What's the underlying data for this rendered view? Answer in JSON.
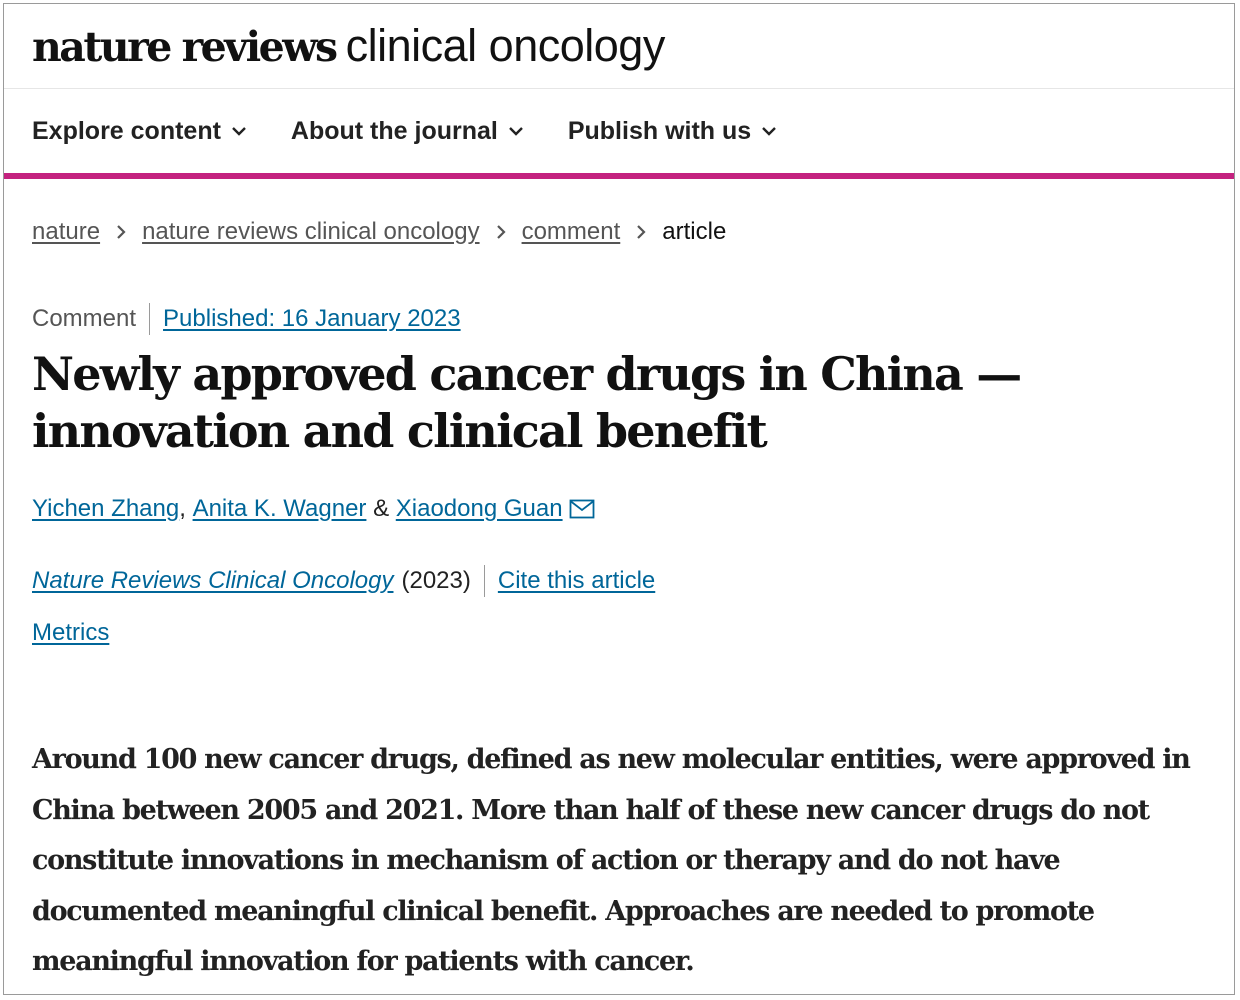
{
  "brand": {
    "name_bold": "nature reviews",
    "name_light": "clinical oncology"
  },
  "nav": {
    "items": [
      {
        "label": "Explore content",
        "icon": "chevron-down-icon"
      },
      {
        "label": "About the journal",
        "icon": "chevron-down-icon"
      },
      {
        "label": "Publish with us",
        "icon": "chevron-down-icon"
      }
    ],
    "accent_color": "#c4227f"
  },
  "breadcrumb": {
    "items": [
      "nature",
      "nature reviews clinical oncology",
      "comment"
    ],
    "current": "article"
  },
  "article": {
    "type": "Comment",
    "published": "Published: 16 January 2023",
    "title": "Newly approved cancer drugs in China — innovation and clinical benefit",
    "authors": [
      "Yichen Zhang",
      "Anita K. Wagner",
      "Xiaodong Guan"
    ],
    "author_separators": [
      ", ",
      " & "
    ],
    "journal": "Nature Reviews Clinical Oncology",
    "year": "(2023)",
    "cite_label": "Cite this article",
    "metrics_label": "Metrics",
    "abstract": "Around 100 new cancer drugs, defined as new molecular entities, were approved in China between 2005 and 2021. More than half of these new cancer drugs do not constitute innovations in mechanism of action or therapy and do not have documented meaningful clinical benefit. Approaches are needed to promote meaningful innovation for patients with cancer."
  },
  "colors": {
    "link": "#006699",
    "text": "#222222"
  }
}
